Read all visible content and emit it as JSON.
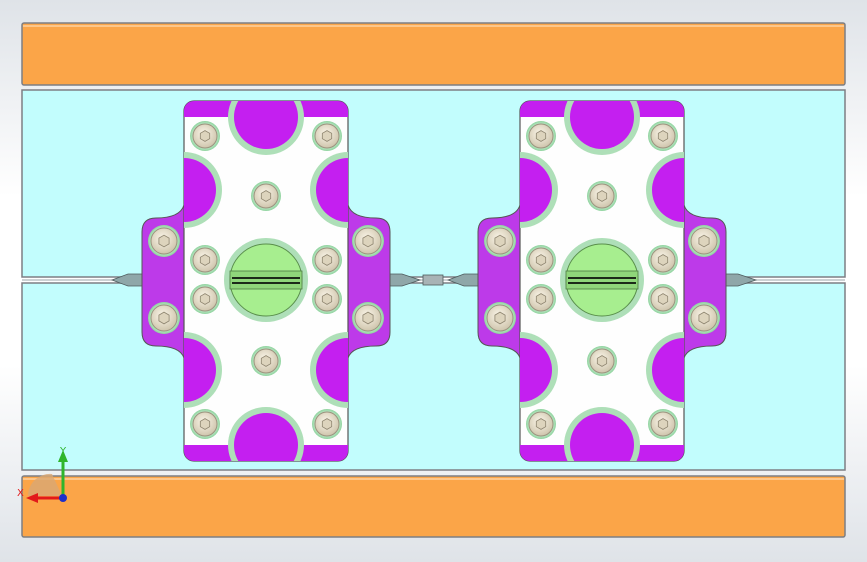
{
  "triad": {
    "x_label": "X",
    "y_label": "Y"
  },
  "colors": {
    "plate": "#fba548",
    "base": "#c2fdfd",
    "clamp_face": "#fefefe",
    "slot": "#c41ff0",
    "tab": "#bd3ae9",
    "counterbore": "#aedfb8",
    "bolt": "#e7dfc9",
    "center_boss": "#a7ee8f",
    "outline": "#7d7e83"
  }
}
